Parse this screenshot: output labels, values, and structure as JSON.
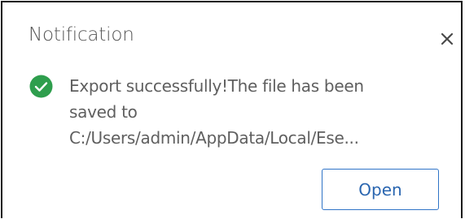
{
  "notification": {
    "title": "Notification",
    "message_lines": [
      "Export successfully!The file has been",
      "saved to",
      "C:/Users/admin/AppData/Local/Ese..."
    ],
    "open_label": "Open",
    "close_icon": "close-icon",
    "status_icon": "check-circle-icon"
  },
  "colors": {
    "success": "#2e9e4d",
    "accent": "#2f74c7",
    "text": "#5f5f5f",
    "border": "#1a1a1a"
  }
}
